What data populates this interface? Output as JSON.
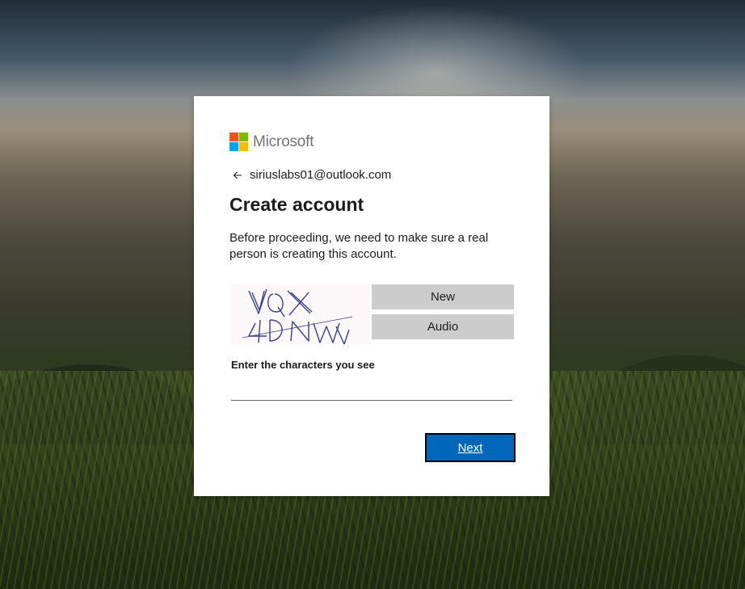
{
  "brand": {
    "name": "Microsoft",
    "logo_colors": [
      "#f25022",
      "#7fba00",
      "#00a4ef",
      "#ffb900"
    ]
  },
  "identity": {
    "icon": "back-arrow-icon",
    "email": "siriuslabs01@outlook.com"
  },
  "heading": "Create account",
  "description": "Before proceeding, we need to make sure a real person is creating this account.",
  "captcha": {
    "image_text": "VQX4DNW",
    "new_label": "New",
    "audio_label": "Audio",
    "input_label": "Enter the characters you see",
    "input_value": ""
  },
  "actions": {
    "next_label": "Next"
  },
  "colors": {
    "primary_button": "#0067b8",
    "captcha_button": "#cccccc"
  }
}
